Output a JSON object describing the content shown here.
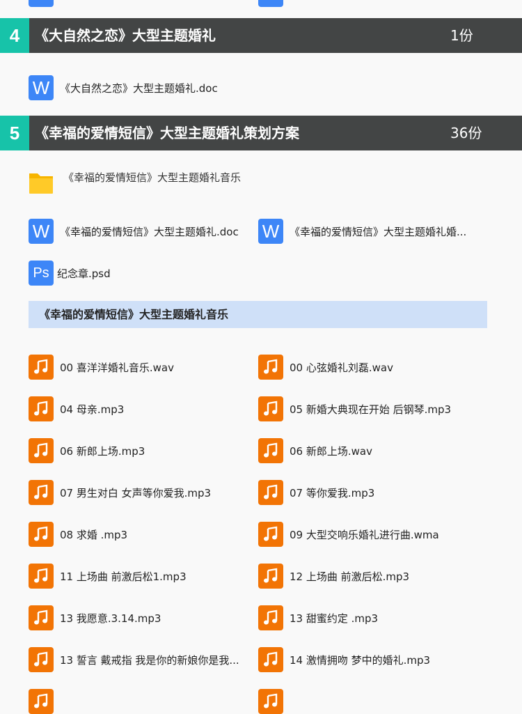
{
  "sections": [
    {
      "number": "4",
      "title": "《大自然之恋》大型主题婚礼",
      "count": "1份",
      "files": [
        {
          "name": "《大自然之恋》大型主题婚礼.doc",
          "icon": "word-icon"
        }
      ]
    },
    {
      "number": "5",
      "title": "《幸福的爱情短信》大型主题婚礼策划方案",
      "count": "36份",
      "folder": "《幸福的爱情短信》大型主题婚礼音乐",
      "files": [
        {
          "name": "《幸福的爱情短信》大型主题婚礼.doc",
          "icon": "word-icon"
        },
        {
          "name": "《幸福的爱情短信》大型主题婚礼婚...",
          "icon": "word-icon"
        },
        {
          "name": "纪念章.psd",
          "icon": "ps-icon"
        }
      ],
      "subfolder_title": "《幸福的爱情短信》大型主题婚礼音乐",
      "music": [
        "00 喜洋洋婚礼音乐.wav",
        "00 心弦婚礼刘磊.wav",
        "04 母亲.mp3",
        "05 新婚大典现在开始 后钢琴.mp3",
        "06 新郎上场.mp3",
        "06 新郎上场.wav",
        "07 男生对白 女声等你爱我.mp3",
        "07 等你爱我.mp3",
        "08 求婚 .mp3",
        "09 大型交响乐婚礼进行曲.wma",
        "11 上场曲 前激后松1.mp3",
        "12 上场曲 前激后松.mp3",
        "13 我愿意.3.14.mp3",
        "13 甜蜜约定 .mp3",
        "13 誓言 戴戒指 我是你的新娘你是我...",
        "14 激情拥吻 梦中的婚礼.mp3"
      ]
    }
  ],
  "icon_labels": {
    "word": "W",
    "ps": "Ps"
  },
  "colors": {
    "teal": "#17c3a9",
    "header": "#434545",
    "word": "#3d86f7",
    "music": "#f27405",
    "band": "#cfe0f8"
  }
}
